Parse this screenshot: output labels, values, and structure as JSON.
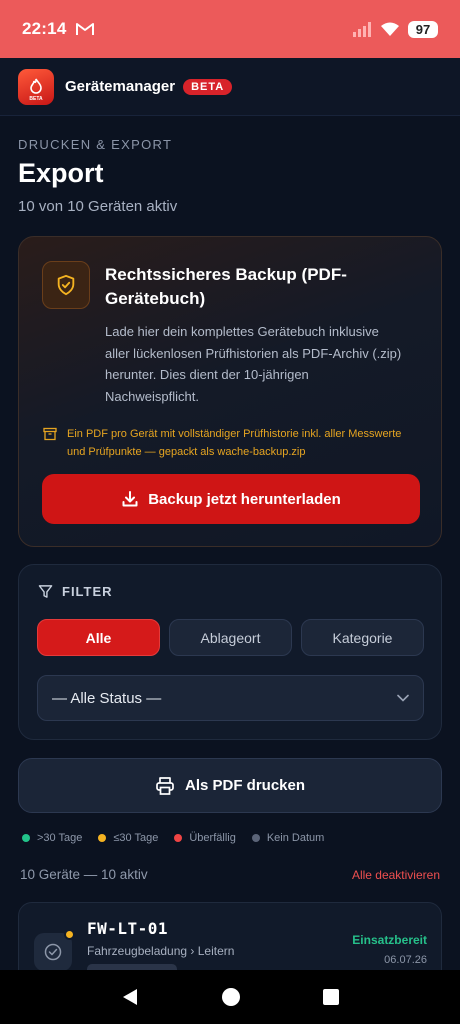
{
  "status_bar": {
    "time": "22:14",
    "battery": "97",
    "icons": [
      "gmail-icon",
      "signal-icon",
      "wifi-icon",
      "battery-icon"
    ]
  },
  "app_bar": {
    "name": "Gerätemanager",
    "badge": "BETA",
    "logo_caption": "BETA"
  },
  "page": {
    "eyebrow": "DRUCKEN & EXPORT",
    "title": "Export",
    "subtitle": "10 von 10 Geräten aktiv"
  },
  "backup": {
    "title": "Rechtssicheres Backup (PDF-Gerätebuch)",
    "description": "Lade hier dein komplettes Gerätebuch inklusive aller lückenlosen Prüfhistorien als PDF-Archiv (.zip) herunter. Dies dient der 10-jährigen Nachweispflicht.",
    "hint": "Ein PDF pro Gerät mit vollständiger Prüfhistorie inkl. aller Messwerte und Prüfpunkte — gepackt als wache-backup.zip",
    "button": "Backup jetzt herunterladen"
  },
  "filter": {
    "heading": "FILTER",
    "pills": [
      "Alle",
      "Ablageort",
      "Kategorie"
    ],
    "active_pill": "Alle",
    "status_select": "— Alle Status —"
  },
  "print": {
    "button": "Als PDF drucken"
  },
  "legend": [
    {
      "label": ">30 Tage",
      "color": "#22c48a"
    },
    {
      "label": "≤30 Tage",
      "color": "#f5b321"
    },
    {
      "label": "Überfällig",
      "color": "#ef4444"
    },
    {
      "label": "Kein Datum",
      "color": "#5b6478"
    }
  ],
  "list": {
    "count": "10 Geräte — 10 aktiv",
    "deactivate_all": "Alle deaktivieren",
    "devices": [
      {
        "id": "FW-LT-01",
        "path": "Fahrzeugbeladung › Leitern",
        "status": "Einsatzbereit",
        "date": "06.07.26",
        "dot_color": "#f5b321"
      }
    ]
  },
  "colors": {
    "accent": "#cf1515",
    "status_bar": "#ec5a5a",
    "background": "#0b1220",
    "hint": "#e6a521",
    "ok": "#26c08a"
  }
}
